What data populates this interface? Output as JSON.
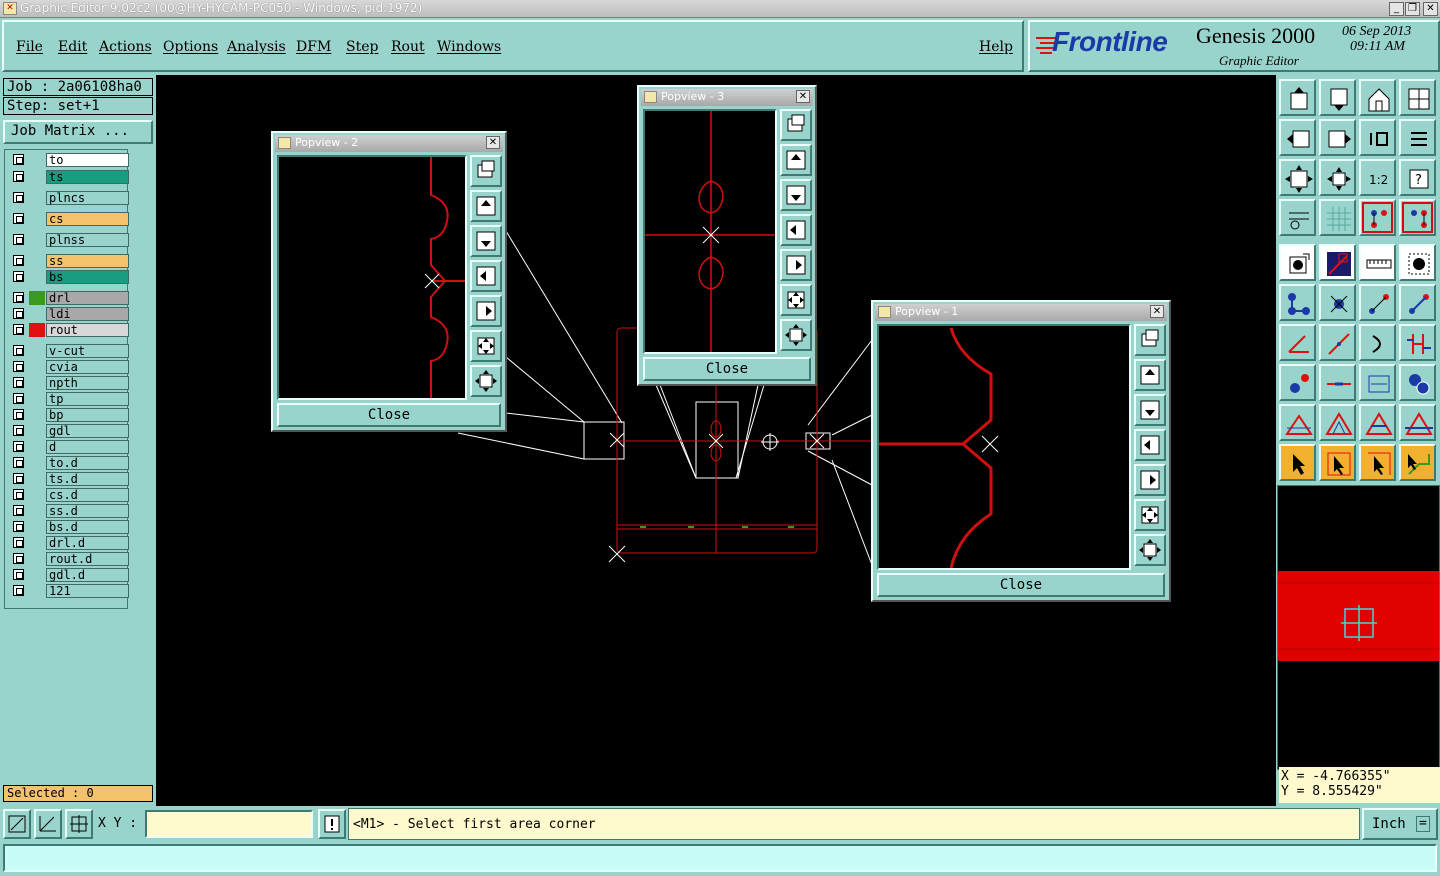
{
  "window": {
    "title": "Graphic Editor 9.02c2 (00@HY-HYCAM-PC050 - Windows, pid:1972)",
    "minimize": "_",
    "restore": "❐",
    "close": "✕"
  },
  "menu": {
    "items": [
      "File",
      "Edit",
      "Actions",
      "Options",
      "Analysis",
      "DFM",
      "Step",
      "Rout",
      "Windows"
    ],
    "help": "Help"
  },
  "brand": {
    "logo": "Frontline",
    "product": "Genesis 2000",
    "subtitle": "Graphic Editor",
    "date": "06 Sep 2013",
    "time": "09:11 AM"
  },
  "job": {
    "job_line": "Job : 2a06108ha0",
    "step_line": "Step: set+1",
    "job_matrix": "Job Matrix ..."
  },
  "layers": [
    {
      "name": "to",
      "color": "#ffffff",
      "swatch": ""
    },
    {
      "name": "ts",
      "color": "#1a9c80",
      "swatch": ""
    },
    {
      "name": "plncs",
      "color": "#98d4cc",
      "swatch": ""
    },
    {
      "name": "cs",
      "color": "#f2c36a",
      "swatch": ""
    },
    {
      "name": "plnss",
      "color": "#98d4cc",
      "swatch": ""
    },
    {
      "name": "ss",
      "color": "#f2c36a",
      "swatch": ""
    },
    {
      "name": "bs",
      "color": "#1a9c80",
      "swatch": ""
    },
    {
      "name": "drl",
      "color": "#a8a8a8",
      "swatch": "#3a9a20"
    },
    {
      "name": "ldi",
      "color": "#a8a8a8",
      "swatch": ""
    },
    {
      "name": "rout",
      "color": "#d8d8d8",
      "swatch": "#e01010"
    },
    {
      "name": "v-cut",
      "color": "#98d4cc",
      "swatch": ""
    },
    {
      "name": "cvia",
      "color": "#98d4cc",
      "swatch": ""
    },
    {
      "name": "npth",
      "color": "#98d4cc",
      "swatch": ""
    },
    {
      "name": "tp",
      "color": "#98d4cc",
      "swatch": ""
    },
    {
      "name": "bp",
      "color": "#98d4cc",
      "swatch": ""
    },
    {
      "name": "gdl",
      "color": "#98d4cc",
      "swatch": ""
    },
    {
      "name": "d",
      "color": "#98d4cc",
      "swatch": ""
    },
    {
      "name": "to.d",
      "color": "#98d4cc",
      "swatch": ""
    },
    {
      "name": "ts.d",
      "color": "#98d4cc",
      "swatch": ""
    },
    {
      "name": "cs.d",
      "color": "#98d4cc",
      "swatch": ""
    },
    {
      "name": "ss.d",
      "color": "#98d4cc",
      "swatch": ""
    },
    {
      "name": "bs.d",
      "color": "#98d4cc",
      "swatch": ""
    },
    {
      "name": "drl.d",
      "color": "#98d4cc",
      "swatch": ""
    },
    {
      "name": "rout.d",
      "color": "#98d4cc",
      "swatch": ""
    },
    {
      "name": "gdl.d",
      "color": "#98d4cc",
      "swatch": ""
    },
    {
      "name": "121",
      "color": "#98d4cc",
      "swatch": ""
    }
  ],
  "selected": "Selected : 0",
  "popviews": {
    "p2": {
      "title": "Popview - 2",
      "close": "Close",
      "x_mark": "✕"
    },
    "p3": {
      "title": "Popview - 3",
      "close": "Close",
      "x_mark": "✕"
    },
    "p1": {
      "title": "Popview - 1",
      "close": "Close",
      "x_mark": "✕"
    }
  },
  "coords": {
    "x": "X = -4.766355\"",
    "y": "Y = 8.555429\""
  },
  "bottom": {
    "xy_label": "X Y :",
    "xy_value": "",
    "prompt": "<M1> - Select first area corner",
    "units": "Inch",
    "units_arrow": "="
  }
}
